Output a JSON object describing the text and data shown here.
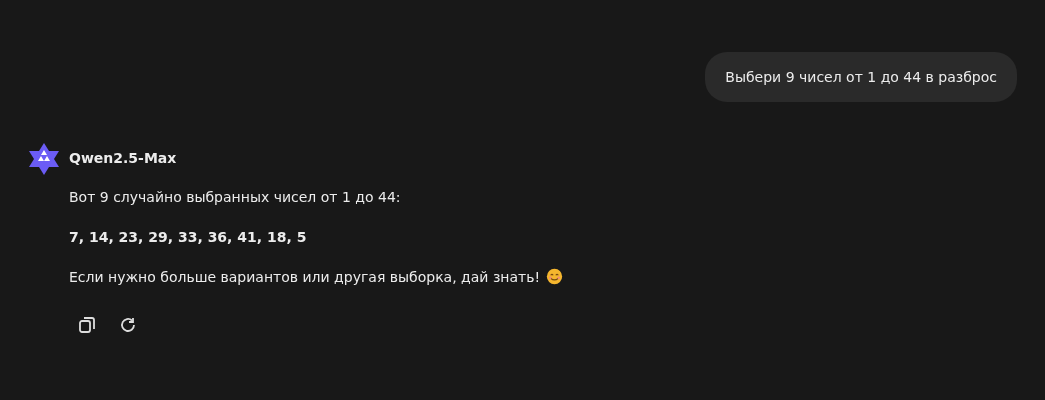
{
  "user_message": {
    "text": "Выбери 9 чисел от 1 до 44 в разброс"
  },
  "assistant": {
    "name": "Qwen2.5-Max",
    "paragraphs": [
      {
        "kind": "plain",
        "text": "Вот 9 случайно выбранных чисел от 1 до 44:"
      },
      {
        "kind": "bold",
        "text": "7, 14, 23, 29, 33, 36, 41, 18, 5"
      },
      {
        "kind": "emoji",
        "text": "Если нужно больше вариантов или другая выборка, дай знать!"
      }
    ],
    "actions": [
      {
        "kind": "copy"
      },
      {
        "kind": "regenerate"
      }
    ]
  }
}
